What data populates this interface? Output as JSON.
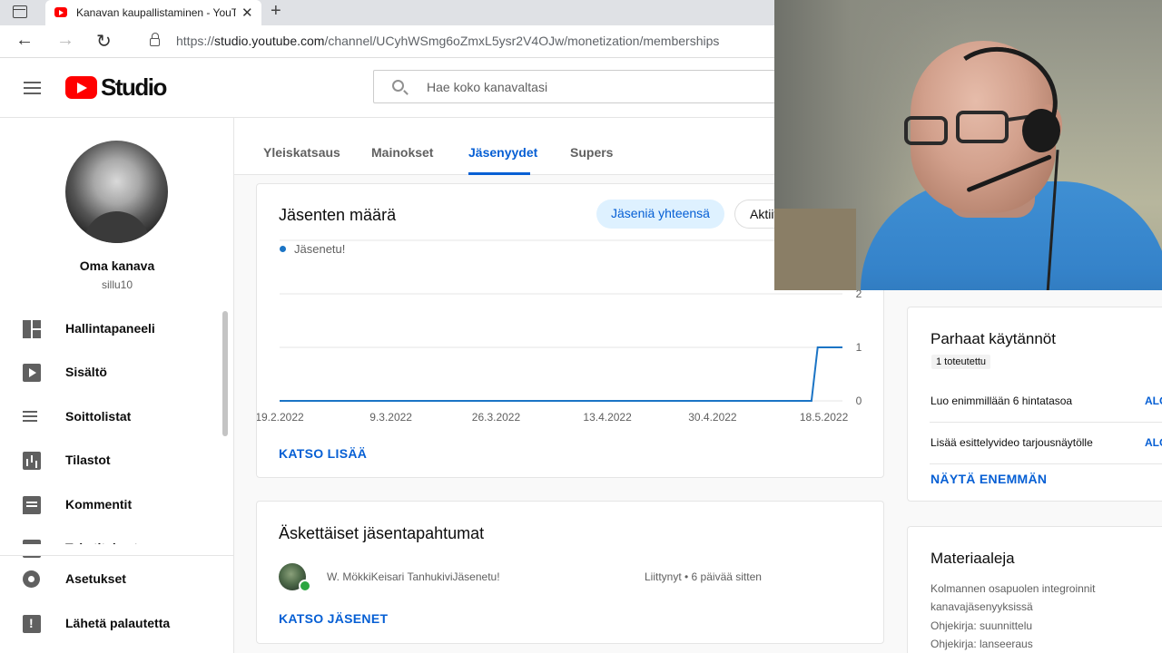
{
  "browser": {
    "tab_title": "Kanavan kaupallistaminen - YouTube Studio",
    "url_prefix": "https://",
    "url_host": "studio.youtube.com",
    "url_path": "/channel/UCyhWSmg6oZmxL5ysr2V4OJw/monetization/memberships"
  },
  "header": {
    "logo_text": "Studio",
    "search_placeholder": "Hae koko kanavaltasi"
  },
  "channel": {
    "name": "Oma kanava",
    "handle": "sillu10"
  },
  "sidebar": {
    "items": [
      {
        "label": "Hallintapaneeli",
        "icon": "dashboard-icon"
      },
      {
        "label": "Sisältö",
        "icon": "content-icon"
      },
      {
        "label": "Soittolistat",
        "icon": "playlist-icon"
      },
      {
        "label": "Tilastot",
        "icon": "analytics-icon"
      },
      {
        "label": "Kommentit",
        "icon": "comments-icon"
      },
      {
        "label": "Tekstitykset",
        "icon": "subtitles-icon"
      }
    ],
    "bottom": [
      {
        "label": "Asetukset",
        "icon": "settings-icon"
      },
      {
        "label": "Lähetä palautetta",
        "icon": "feedback-icon"
      }
    ]
  },
  "tabs": [
    "Yleiskatsaus",
    "Mainokset",
    "Jäsenyydet",
    "Supers"
  ],
  "active_tab": "Jäsenyydet",
  "members_card": {
    "title": "Jäsenten määrä",
    "chip_total": "Jäseniä yhteensä",
    "chip_active": "Aktiiv",
    "see_more": "KATSO LISÄÄ"
  },
  "chart_data": {
    "type": "line",
    "title": "Jäsenten määrä",
    "series": [
      {
        "name": "Jäsenetu!",
        "color": "#1b74c5",
        "points": [
          [
            "2022-02-19",
            0
          ],
          [
            "2022-05-16",
            0
          ],
          [
            "2022-05-17",
            1
          ],
          [
            "2022-05-21",
            1
          ]
        ]
      }
    ],
    "x_tick_labels": [
      "19.2.2022",
      "9.3.2022",
      "26.3.2022",
      "13.4.2022",
      "30.4.2022",
      "18.5.2022"
    ],
    "x_ticks": [
      "2022-02-19",
      "2022-03-09",
      "2022-03-26",
      "2022-04-13",
      "2022-04-30",
      "2022-05-18"
    ],
    "xlim": [
      "2022-02-19",
      "2022-05-21"
    ],
    "y_ticks": [
      0,
      1,
      2
    ],
    "ylim": [
      0,
      3
    ],
    "grid": true,
    "legend": "top-left"
  },
  "recent_card": {
    "title": "Äskettäiset jäsentapahtumat",
    "events": [
      {
        "name": "W. MökkiKeisari TanhukiviJäsenetu!",
        "time": "Liittynyt • 6 päivää sitten"
      }
    ],
    "see_members": "KATSO JÄSENET"
  },
  "best_practices": {
    "title": "Parhaat käytännöt",
    "badge": "1 toteutettu",
    "items": [
      {
        "text": "Luo enimmillään 6 hintatasoa",
        "action": "ALOITA"
      },
      {
        "text": "Lisää esittelyvideo tarjousnäytölle",
        "action": "ALOITA"
      }
    ],
    "show_more": "NÄYTÄ ENEMMÄN"
  },
  "materials": {
    "title": "Materiaaleja",
    "lines": [
      "Kolmannen osapuolen integroinnit",
      "kanavajäsenyyksissä",
      "Ohjekirja: suunnittelu",
      "Ohjekirja: lanseeraus"
    ]
  }
}
